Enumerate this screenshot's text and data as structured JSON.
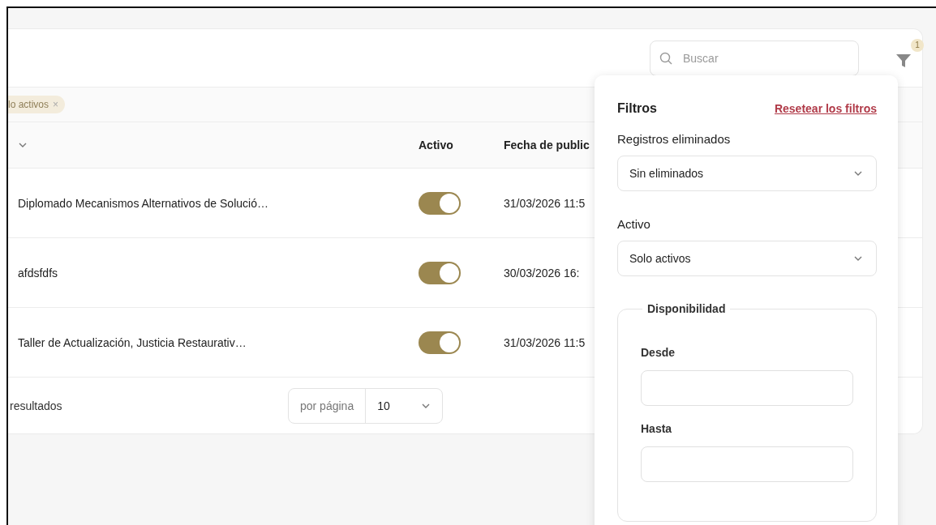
{
  "search": {
    "placeholder": "Buscar"
  },
  "filter_button": {
    "badge": "1"
  },
  "active_chips": [
    {
      "label": "lo activos",
      "remove": "×"
    }
  ],
  "table": {
    "columns": [
      {
        "sortable": true
      },
      {
        "label": "Activo",
        "sortable": false
      },
      {
        "label": "Fecha de public",
        "sortable": false
      }
    ],
    "rows": [
      {
        "name": "Diplomado Mecanismos Alternativos de Solució…",
        "active": true,
        "date": "31/03/2026 11:5"
      },
      {
        "name": "afdsfdfs",
        "active": true,
        "date": "30/03/2026 16:"
      },
      {
        "name": "Taller de Actualización, Justicia Restaurativ…",
        "active": true,
        "date": "31/03/2026 11:5"
      }
    ]
  },
  "footer": {
    "results": "resultados",
    "per_page_label": "por página",
    "per_page_value": "10"
  },
  "filters_panel": {
    "title": "Filtros",
    "reset_link": "Resetear los filtros",
    "fields": [
      {
        "kind": "select",
        "label": "Registros eliminados",
        "value": "Sin eliminados"
      },
      {
        "kind": "select",
        "label": "Activo",
        "value": "Solo activos"
      },
      {
        "kind": "group",
        "label": "Disponibilidad",
        "children": [
          {
            "kind": "input",
            "label": "Desde"
          },
          {
            "kind": "input",
            "label": "Hasta"
          }
        ]
      }
    ]
  }
}
